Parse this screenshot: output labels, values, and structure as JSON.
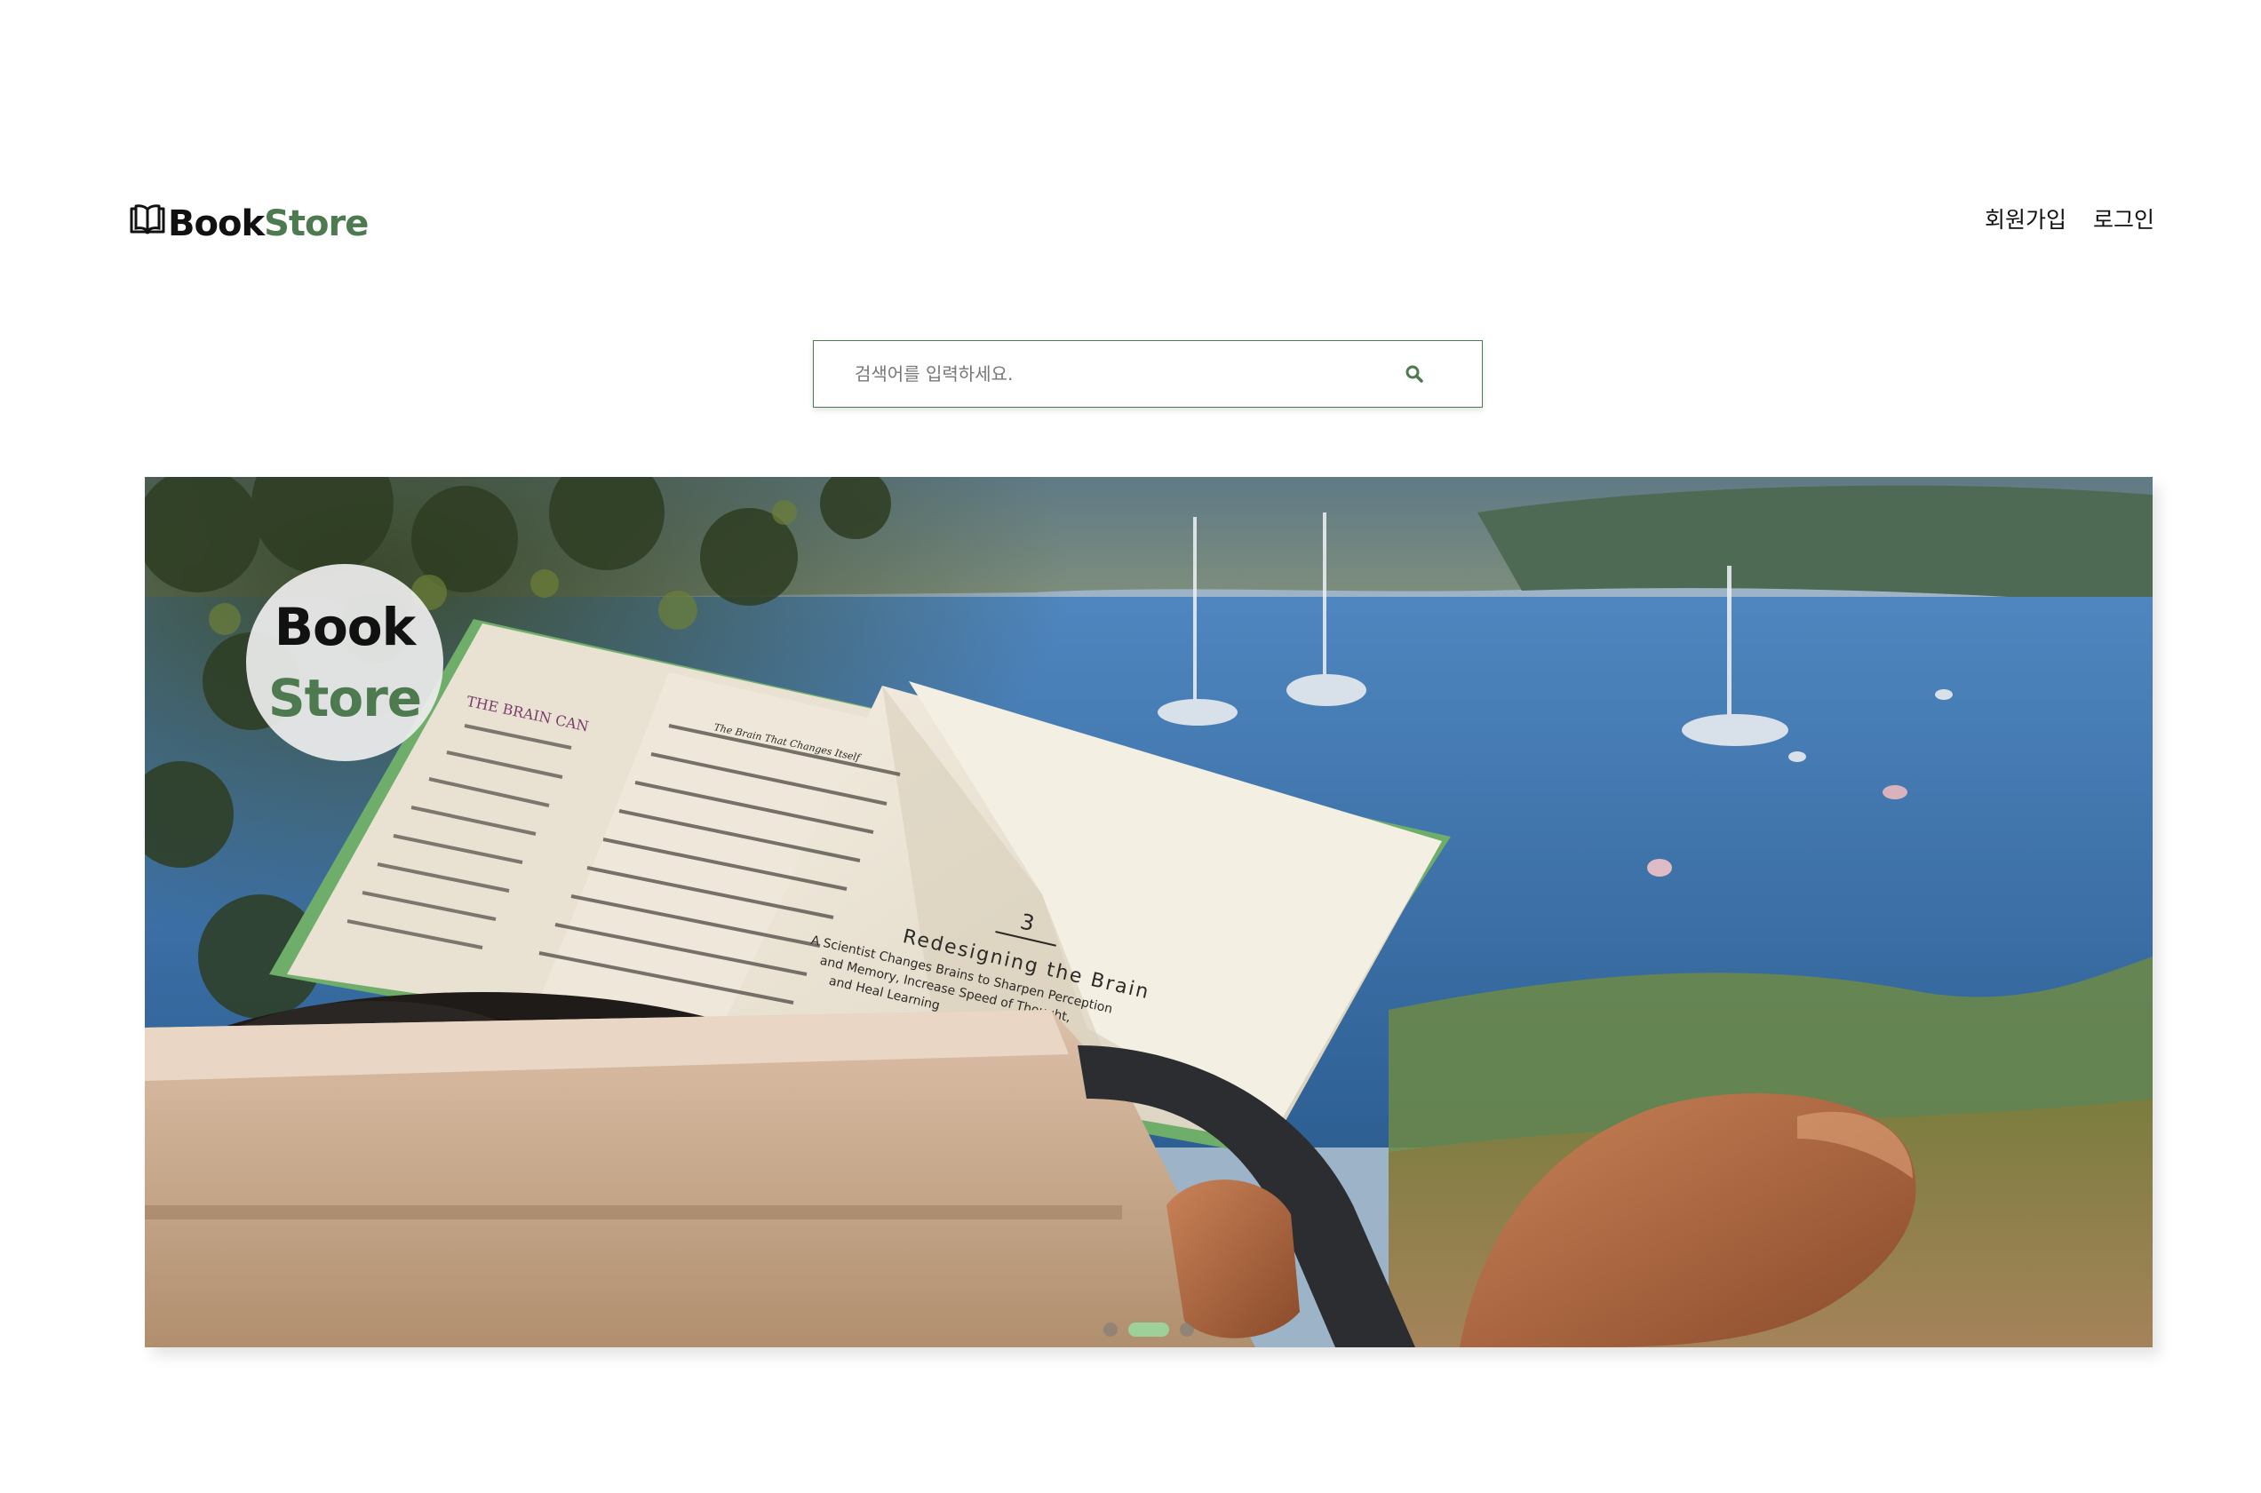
{
  "header": {
    "logo": {
      "part1": "Book",
      "part2": "Store"
    },
    "nav": [
      {
        "label": "회원가입"
      },
      {
        "label": "로그인"
      }
    ]
  },
  "search": {
    "placeholder": "검색어를 입력하세요.",
    "value": ""
  },
  "hero": {
    "badge": {
      "line1": "Book",
      "line2": "Store"
    },
    "book_page": {
      "chapter_number": "3",
      "chapter_title": "Redesigning the Brain",
      "chapter_subtitle_1": "A Scientist Changes Brains to Sharpen Perception",
      "chapter_subtitle_2": "and Memory, Increase Speed of Thought,",
      "chapter_subtitle_3": "and Heal Learning",
      "left_header": "THE BRAIN CAN",
      "mid_header": "The Brain That Changes Itself"
    },
    "carousel": {
      "slide_count": 3,
      "active_index": 1
    }
  },
  "colors": {
    "brand_green": "#4d7a4f",
    "active_dot": "#9ed19a",
    "text_dark": "#111111"
  },
  "icons": {
    "logo": "open-book-icon",
    "search": "magnifier-icon"
  }
}
